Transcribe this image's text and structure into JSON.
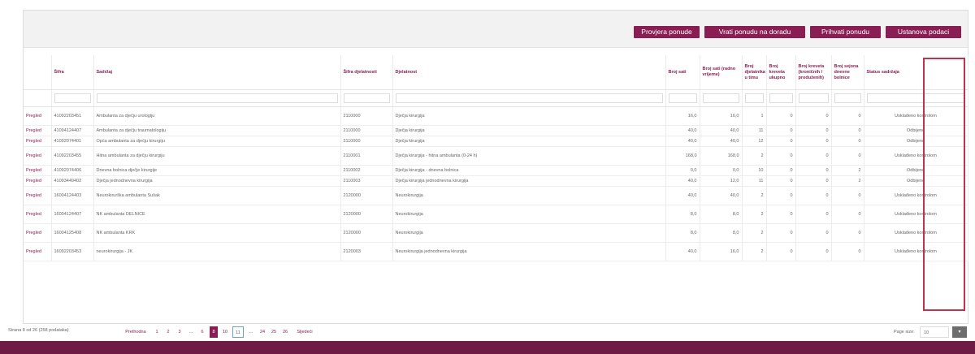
{
  "toolbar": {
    "buttons": [
      "Provjera ponude",
      "Vrati ponudu na doradu",
      "Prihvati ponudu",
      "Ustanova podaci"
    ]
  },
  "table": {
    "headers": [
      "",
      "Šifra",
      "Sadržaj",
      "Šifra djelatnosti",
      "Djelatnost",
      "Broj sati",
      "Broj sati (radno vrijeme)",
      "Broj djelatnika u timu",
      "Broj kreveta ukupno",
      "Broj kreveta (kroničnih / produženih)",
      "Broj sejona dnevne bolnice",
      "Status sadržaja"
    ],
    "rows": [
      {
        "action": "Pregled",
        "code": "41092203451",
        "name": "Ambulanta za dječju urologiju",
        "dcode": "2110000",
        "dname": "Dječja kirurgija",
        "hours": "16,0",
        "hours_rv": "16,0",
        "staff": "1",
        "beds": "0",
        "beds_chr": "0",
        "day": "0",
        "status": "Usklađeno kontrolom"
      },
      {
        "action": "Pregled",
        "code": "41094124407",
        "name": "Ambulanta za dječju traumatologiju",
        "dcode": "2110000",
        "dname": "Dječja kirurgija",
        "hours": "40,0",
        "hours_rv": "40,0",
        "staff": "11",
        "beds": "0",
        "beds_chr": "0",
        "day": "0",
        "status": "Odbijeno"
      },
      {
        "action": "Pregled",
        "code": "41092074401",
        "name": "Opća ambulanta za dječju kirurgiju",
        "dcode": "2110000",
        "dname": "Dječja kirurgija",
        "hours": "40,0",
        "hours_rv": "40,0",
        "staff": "12",
        "beds": "0",
        "beds_chr": "0",
        "day": "0",
        "status": "Odbijeno"
      },
      {
        "action": "Pregled",
        "code": "41092203455",
        "name": "Hitna ambulanta za dječju kirurgiju",
        "dcode": "2110001",
        "dname": "Dječja kirurgija - hitna ambulanta (0-24 h)",
        "hours": "168,0",
        "hours_rv": "168,0",
        "staff": "2",
        "beds": "0",
        "beds_chr": "0",
        "day": "0",
        "status": "Usklađeno kontrolom"
      },
      {
        "action": "Pregled",
        "code": "41092074406",
        "name": "Dnevna bolnica dječje kirurgije",
        "dcode": "2110002",
        "dname": "Dječja kirurgija - dnevna bolnica",
        "hours": "0,0",
        "hours_rv": "0,0",
        "staff": "10",
        "beds": "0",
        "beds_chr": "0",
        "day": "2",
        "status": "Odbijeno"
      },
      {
        "action": "Pregled",
        "code": "41093449402",
        "name": "Dječja jednodnevna kirurgija",
        "dcode": "2110003",
        "dname": "Dječja kirurgija jednodnevna kirurgija",
        "hours": "40,0",
        "hours_rv": "12,0",
        "staff": "11",
        "beds": "0",
        "beds_chr": "0",
        "day": "2",
        "status": "Odbijeno"
      },
      {
        "action": "Pregled",
        "code": "16004124403",
        "name": "Neurokirurška ambulanta Sušak",
        "dcode": "2120000",
        "dname": "Neurokirurgija",
        "hours": "40,0",
        "hours_rv": "40,0",
        "staff": "2",
        "beds": "0",
        "beds_chr": "0",
        "day": "0",
        "status": "Usklađeno kontrolom"
      },
      {
        "action": "Pregled",
        "code": "16004124407",
        "name": "NK ambulanta DELNICE",
        "dcode": "2120000",
        "dname": "Neurokirurgija",
        "hours": "8,0",
        "hours_rv": "8,0",
        "staff": "2",
        "beds": "0",
        "beds_chr": "0",
        "day": "0",
        "status": "Usklađeno kontrolom"
      },
      {
        "action": "Pregled",
        "code": "16004125408",
        "name": "NK ambulanta KRK",
        "dcode": "2120000",
        "dname": "Neurokirurgija",
        "hours": "8,0",
        "hours_rv": "8,0",
        "staff": "2",
        "beds": "0",
        "beds_chr": "0",
        "day": "0",
        "status": "Usklađeno kontrolom"
      },
      {
        "action": "Pregled",
        "code": "16092203453",
        "name": "neurokirurgija - JK",
        "dcode": "2120003",
        "dname": "Neurokirurgija jednodnevna kirurgija",
        "hours": "40,0",
        "hours_rv": "16,0",
        "staff": "2",
        "beds": "0",
        "beds_chr": "0",
        "day": "0",
        "status": "Usklađeno kontrolom"
      }
    ]
  },
  "pager": {
    "summary": "Strana 8 od 26 (258 podataka)",
    "prev": "Prethodna",
    "pages": [
      "1",
      "2",
      "3",
      "...",
      "6",
      "8",
      "10",
      "11",
      "...",
      "24",
      "25",
      "26"
    ],
    "active": "8",
    "next": "Sljedeći",
    "page_size_label": "Page size:",
    "page_size_value": "10"
  },
  "colors": {
    "accent": "#8a1d54",
    "footer": "#6e1b46",
    "highlight": "#c0334e"
  }
}
